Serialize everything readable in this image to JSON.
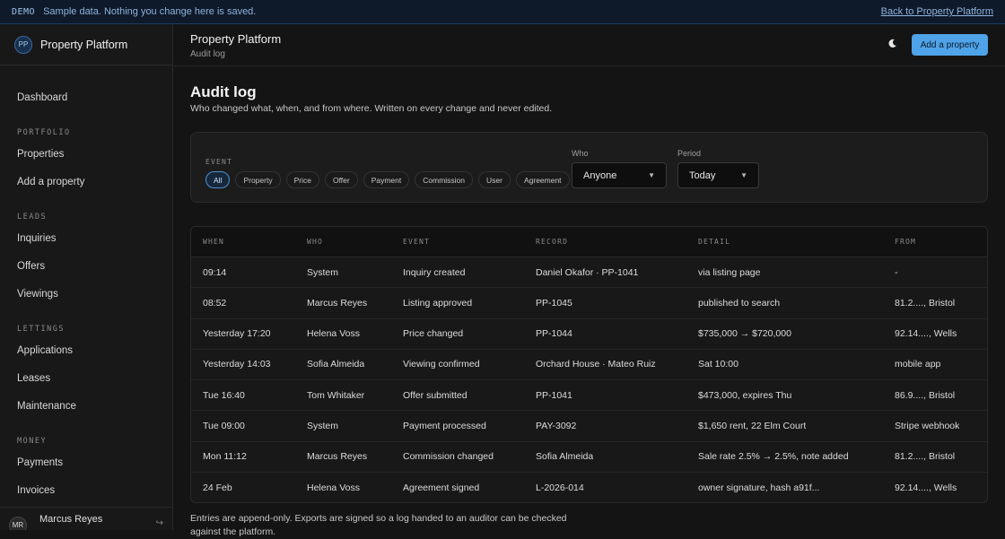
{
  "banner": {
    "tag": "DEMO",
    "message": "Sample data. Nothing you change here is saved.",
    "back_link": "Back to Property Platform"
  },
  "sidebar": {
    "brand_initials": "PP",
    "brand_name": "Property Platform",
    "dashboard": "Dashboard",
    "sections": [
      {
        "label": "PORTFOLIO",
        "items": [
          "Properties",
          "Add a property"
        ]
      },
      {
        "label": "LEADS",
        "items": [
          "Inquiries",
          "Offers",
          "Viewings"
        ]
      },
      {
        "label": "LETTINGS",
        "items": [
          "Applications",
          "Leases",
          "Maintenance"
        ]
      },
      {
        "label": "MONEY",
        "items": [
          "Payments",
          "Invoices"
        ]
      }
    ],
    "user_initials": "MR",
    "user_name": "Marcus Reyes"
  },
  "topbar": {
    "title": "Property Platform",
    "subtitle": "Audit log",
    "add_button": "Add a property"
  },
  "page": {
    "title": "Audit log",
    "subtitle": "Who changed what, when, and from where. Written on every change and never edited."
  },
  "filters": {
    "event_label": "EVENT",
    "chips": [
      "All",
      "Property",
      "Price",
      "Offer",
      "Payment",
      "Commission",
      "User",
      "Agreement"
    ],
    "active_chip": "All",
    "who_label": "Who",
    "who_value": "Anyone",
    "period_label": "Period",
    "period_value": "Today"
  },
  "table": {
    "headers": [
      "WHEN",
      "WHO",
      "EVENT",
      "RECORD",
      "DETAIL",
      "FROM"
    ],
    "rows": [
      [
        "09:14",
        "System",
        "Inquiry created",
        "Daniel Okafor · PP-1041",
        "via listing page",
        "-"
      ],
      [
        "08:52",
        "Marcus Reyes",
        "Listing approved",
        "PP-1045",
        "published to search",
        "81.2...., Bristol"
      ],
      [
        "Yesterday 17:20",
        "Helena Voss",
        "Price changed",
        "PP-1044",
        "$735,000 → $720,000",
        "92.14...., Wells"
      ],
      [
        "Yesterday 14:03",
        "Sofia Almeida",
        "Viewing confirmed",
        "Orchard House · Mateo Ruiz",
        "Sat 10:00",
        "mobile app"
      ],
      [
        "Tue 16:40",
        "Tom Whitaker",
        "Offer submitted",
        "PP-1041",
        "$473,000, expires Thu",
        "86.9...., Bristol"
      ],
      [
        "Tue 09:00",
        "System",
        "Payment processed",
        "PAY-3092",
        "$1,650 rent, 22 Elm Court",
        "Stripe webhook"
      ],
      [
        "Mon 11:12",
        "Marcus Reyes",
        "Commission changed",
        "Sofia Almeida",
        "Sale rate 2.5% → 2.5%, note added",
        "81.2...., Bristol"
      ],
      [
        "24 Feb",
        "Helena Voss",
        "Agreement signed",
        "L-2026-014",
        "owner signature, hash a91f...",
        "92.14...., Wells"
      ]
    ]
  },
  "footnote": "Entries are append-only. Exports are signed so a log handed to an auditor can be checked against the platform."
}
